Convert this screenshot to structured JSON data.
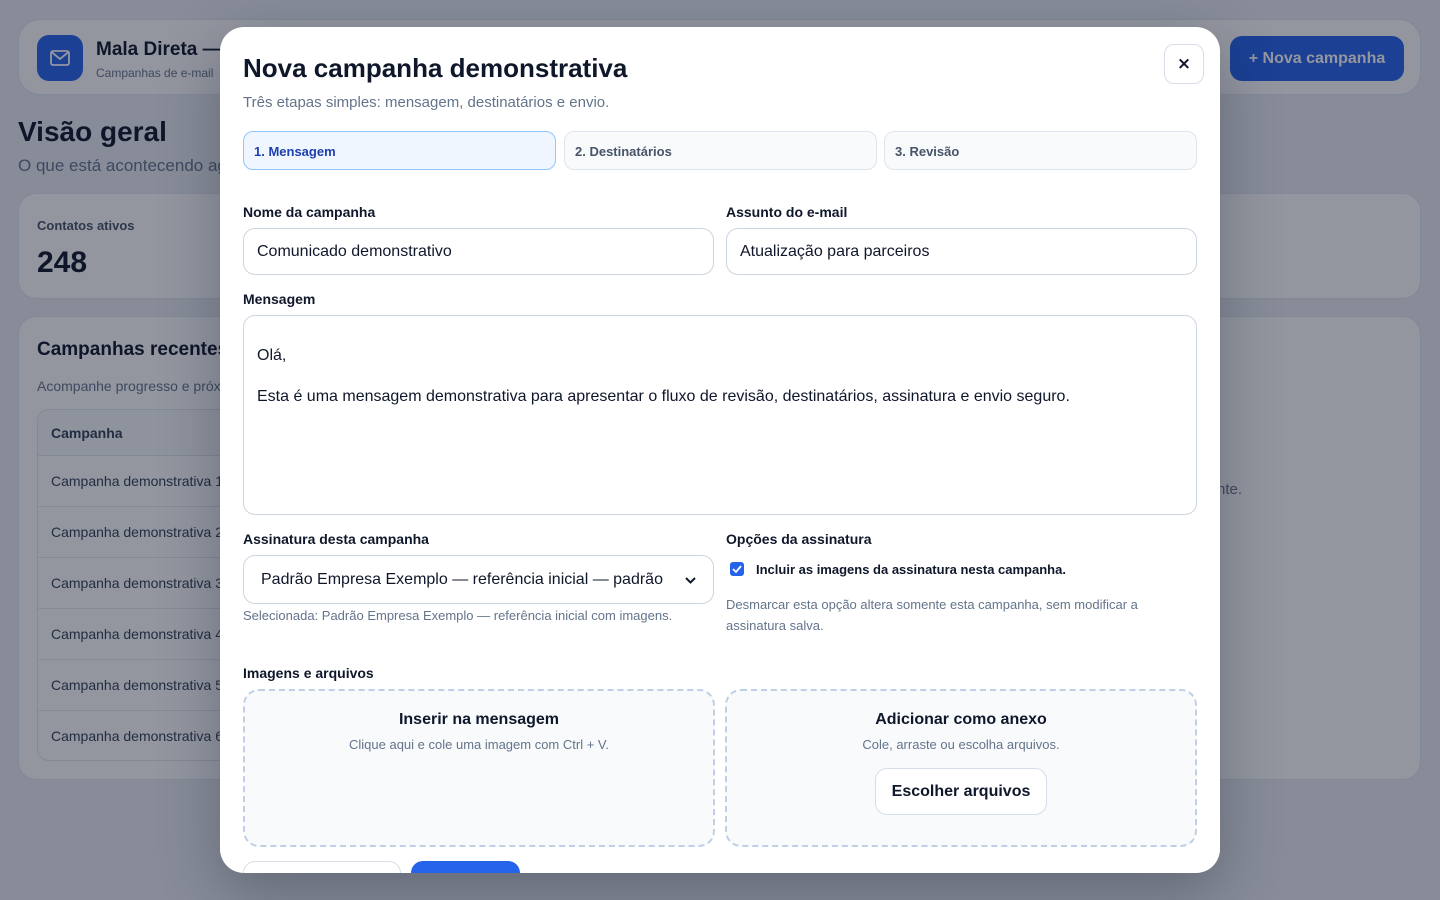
{
  "app": {
    "title": "Mala Direta —",
    "subtitle": "Campanhas de e-mail",
    "new_campaign_label": "+ Nova campanha"
  },
  "overview": {
    "title": "Visão geral",
    "subtitle": "O que está acontecendo agora"
  },
  "stats": {
    "active_contacts_label": "Contatos ativos",
    "active_contacts_value": "248"
  },
  "campaigns": {
    "title": "Campanhas recentes",
    "subtitle": "Acompanhe progresso e próximos envios",
    "column_header": "Campanha",
    "rows": [
      "Campanha demonstrativa 1",
      "Campanha demonstrativa 2",
      "Campanha demonstrativa 3",
      "Campanha demonstrativa 4",
      "Campanha demonstrativa 5",
      "Campanha demonstrativa 6"
    ],
    "side_fragment": "nte."
  },
  "modal": {
    "title": "Nova campanha demonstrativa",
    "subtitle": "Três etapas simples: mensagem, destinatários e envio.",
    "close_label": "×",
    "steps": [
      "1. Mensagem",
      "2. Destinatários",
      "3. Revisão"
    ],
    "active_step": 0,
    "name_label": "Nome da campanha",
    "name_value": "Comunicado demonstrativo",
    "subject_label": "Assunto do e-mail",
    "subject_value": "Atualização para parceiros",
    "message_label": "Mensagem",
    "message_lines": [
      "Olá,",
      "Esta é uma mensagem demonstrativa para apresentar o fluxo de revisão, destinatários, assinatura e envio seguro."
    ],
    "signature_label": "Assinatura desta campanha",
    "signature_selected": "Padrão Empresa Exemplo — referência inicial — padrão",
    "signature_hint": "Selecionada: Padrão Empresa Exemplo — referência inicial com imagens.",
    "signature_options_label": "Opções da assinatura",
    "include_images_checked": true,
    "include_images_label": "Incluir as imagens da assinatura nesta campanha.",
    "include_images_hint": "Desmarcar esta opção altera somente esta campanha, sem modificar a assinatura salva.",
    "files_label": "Imagens e arquivos",
    "inline_title": "Inserir na mensagem",
    "inline_sub": "Clique aqui e cole uma imagem com Ctrl + V.",
    "attach_title": "Adicionar como anexo",
    "attach_sub": "Cole, arraste ou escolha arquivos.",
    "choose_files_label": "Escolher arquivos"
  },
  "colors": {
    "accent": "#2563eb",
    "active_step_bg": "#eff6ff",
    "active_step_text": "#1e40af"
  },
  "icons": {
    "app_logo": "envelope-icon",
    "close": "close-icon",
    "select_caret": "chevron-down-icon",
    "checkbox": "check-icon"
  }
}
